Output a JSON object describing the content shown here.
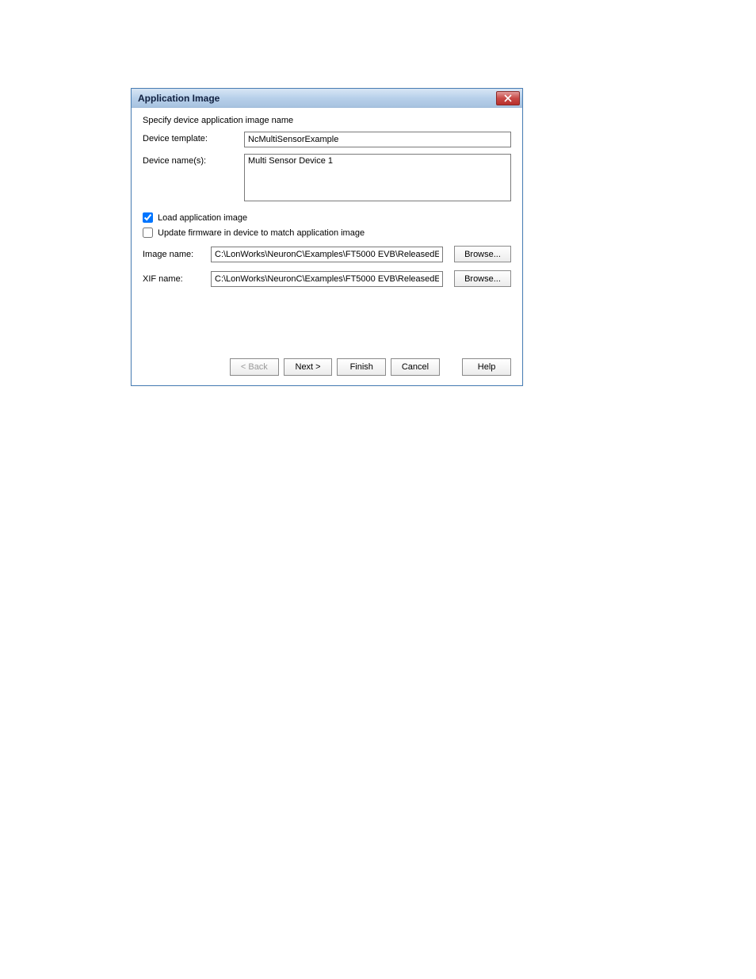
{
  "titlebar": {
    "title": "Application Image"
  },
  "instruction": "Specify device application image name",
  "fields": {
    "device_template_label": "Device template:",
    "device_template_value": "NcMultiSensorExample",
    "device_names_label": "Device name(s):",
    "device_names_value": "Multi Sensor Device 1"
  },
  "checkboxes": {
    "load_app_label": "Load application image",
    "load_app_checked": true,
    "update_fw_label": "Update firmware in device to match application image",
    "update_fw_checked": false
  },
  "paths": {
    "image_name_label": "Image name:",
    "image_name_value": "C:\\LonWorks\\NeuronC\\Examples\\FT5000 EVB\\ReleasedE",
    "xif_name_label": "XIF name:",
    "xif_name_value": "C:\\LonWorks\\NeuronC\\Examples\\FT5000 EVB\\ReleasedE",
    "browse_label": "Browse..."
  },
  "buttons": {
    "back": "< Back",
    "next": "Next >",
    "finish": "Finish",
    "cancel": "Cancel",
    "help": "Help"
  }
}
